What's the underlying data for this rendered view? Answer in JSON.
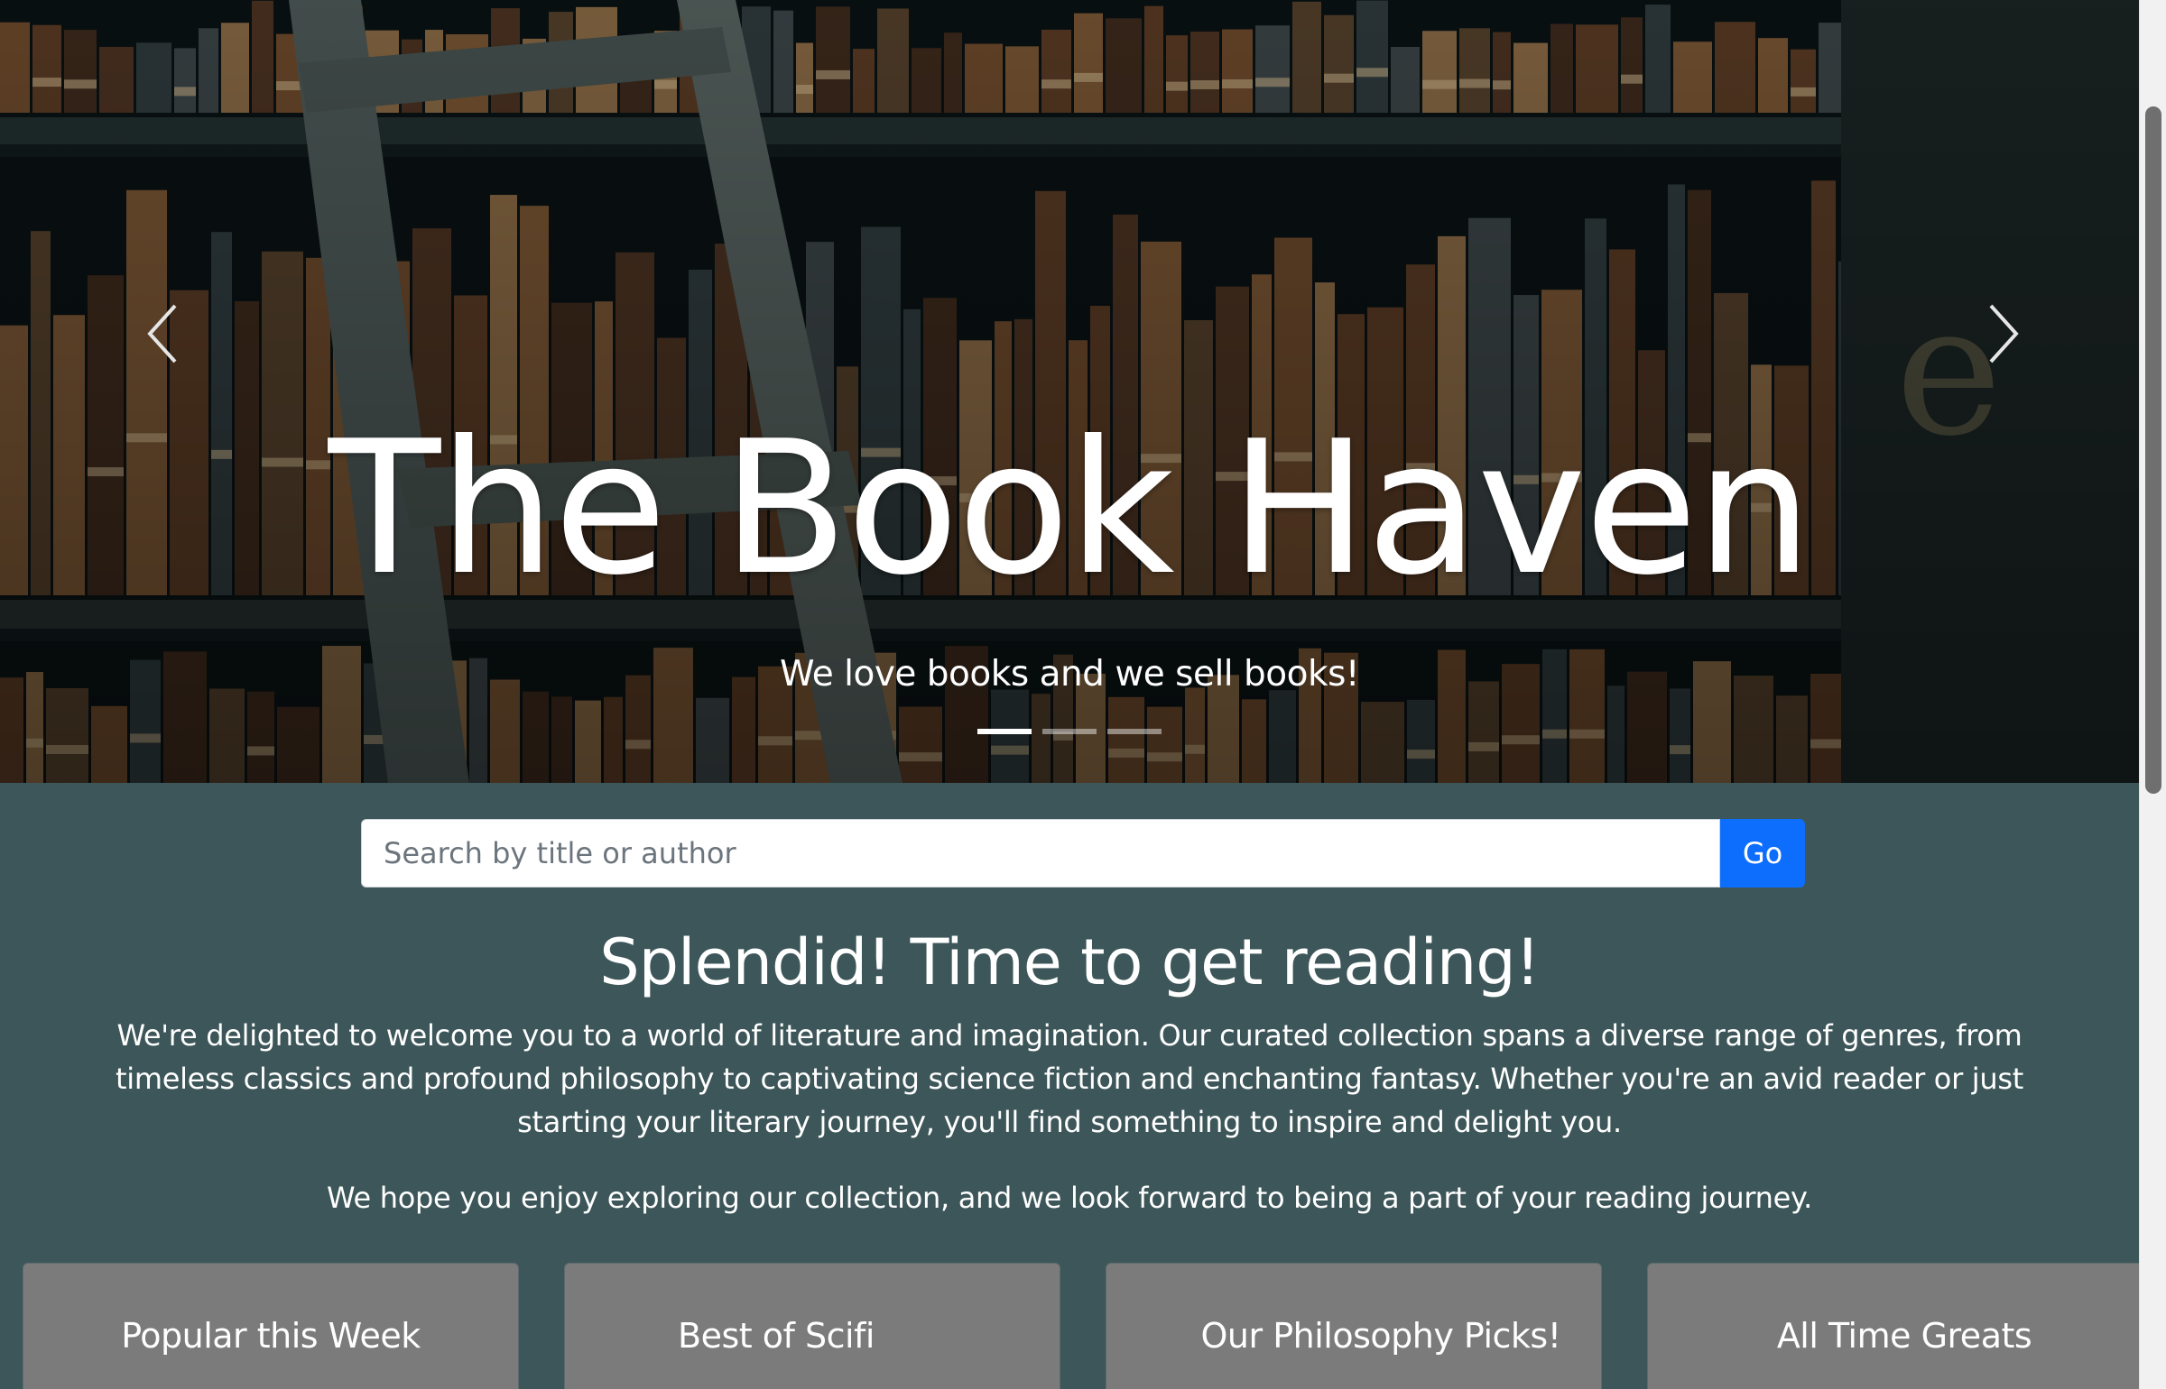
{
  "hero": {
    "title": "The Book Haven",
    "caption": "We love books and we sell books!",
    "slide_count": 3,
    "active_slide": 1,
    "prev_icon": "chevron-left-icon",
    "next_icon": "chevron-right-icon"
  },
  "search": {
    "placeholder": "Search by title or author",
    "value": "",
    "button_label": "Go"
  },
  "welcome": {
    "heading": "Splendid! Time to get reading!",
    "paragraph1": "We're delighted to welcome you to a world of literature and imagination. Our curated collection spans a diverse range of genres, from timeless classics and profound philosophy to captivating science fiction and enchanting fantasy. Whether you're an avid reader or just starting your literary journey, you'll find something to inspire and delight you.",
    "paragraph2": "We hope you enjoy exploring our collection, and we look forward to being a part of your reading journey."
  },
  "categories": [
    {
      "label": "Popular this Week"
    },
    {
      "label": "Best of Scifi"
    },
    {
      "label": "Our Philosophy Picks!"
    },
    {
      "label": "All Time Greats"
    }
  ],
  "colors": {
    "page_background": "#3d5659",
    "primary_button": "#0d6efd",
    "card_background": "#7b7b7b",
    "text": "#ffffff"
  }
}
